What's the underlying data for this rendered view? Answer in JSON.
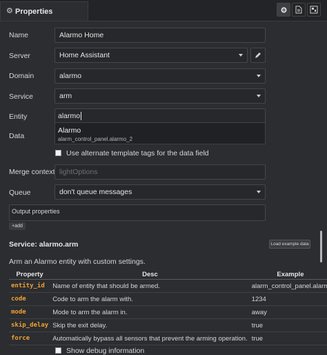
{
  "header": {
    "tab_title": "Properties"
  },
  "form": {
    "name": {
      "label": "Name",
      "value": "Alarmo Home"
    },
    "server": {
      "label": "Server",
      "value": "Home Assistant"
    },
    "domain": {
      "label": "Domain",
      "value": "alarmo"
    },
    "service": {
      "label": "Service",
      "value": "arm"
    },
    "entity": {
      "label": "Entity",
      "value": "alarmo"
    },
    "entity_suggestion": {
      "name": "Alarmo",
      "entity_id": "alarm_control_panel.alarmo_2"
    },
    "data": {
      "label": "Data"
    },
    "alt_tags": {
      "label": "Use alternate template tags for the data field",
      "checked": false
    },
    "merge_context": {
      "label": "Merge context",
      "placeholder": "lightOptions"
    },
    "queue": {
      "label": "Queue",
      "value": "don't queue messages"
    },
    "output_properties": {
      "label": "Output properties",
      "add_label": "add"
    }
  },
  "service_doc": {
    "title": "Service: alarmo.arm",
    "load_button": "Load example data",
    "description": "Arm an Alarmo entity with custom settings.",
    "headers": [
      "Property",
      "Desc",
      "Example"
    ],
    "rows": [
      {
        "property": "entity_id",
        "desc": "Name of entity that should be armed.",
        "example": "alarm_control_panel.alarm"
      },
      {
        "property": "code",
        "desc": "Code to arm the alarm with.",
        "example": "1234"
      },
      {
        "property": "mode",
        "desc": "Mode to arm the alarm in.",
        "example": "away"
      },
      {
        "property": "skip_delay",
        "desc": "Skip the exit delay.",
        "example": "true"
      },
      {
        "property": "force",
        "desc": "Automatically bypass all sensors that prevent the arming operation.",
        "example": "true"
      }
    ]
  },
  "debug": {
    "label": "Show debug information",
    "checked": false
  }
}
